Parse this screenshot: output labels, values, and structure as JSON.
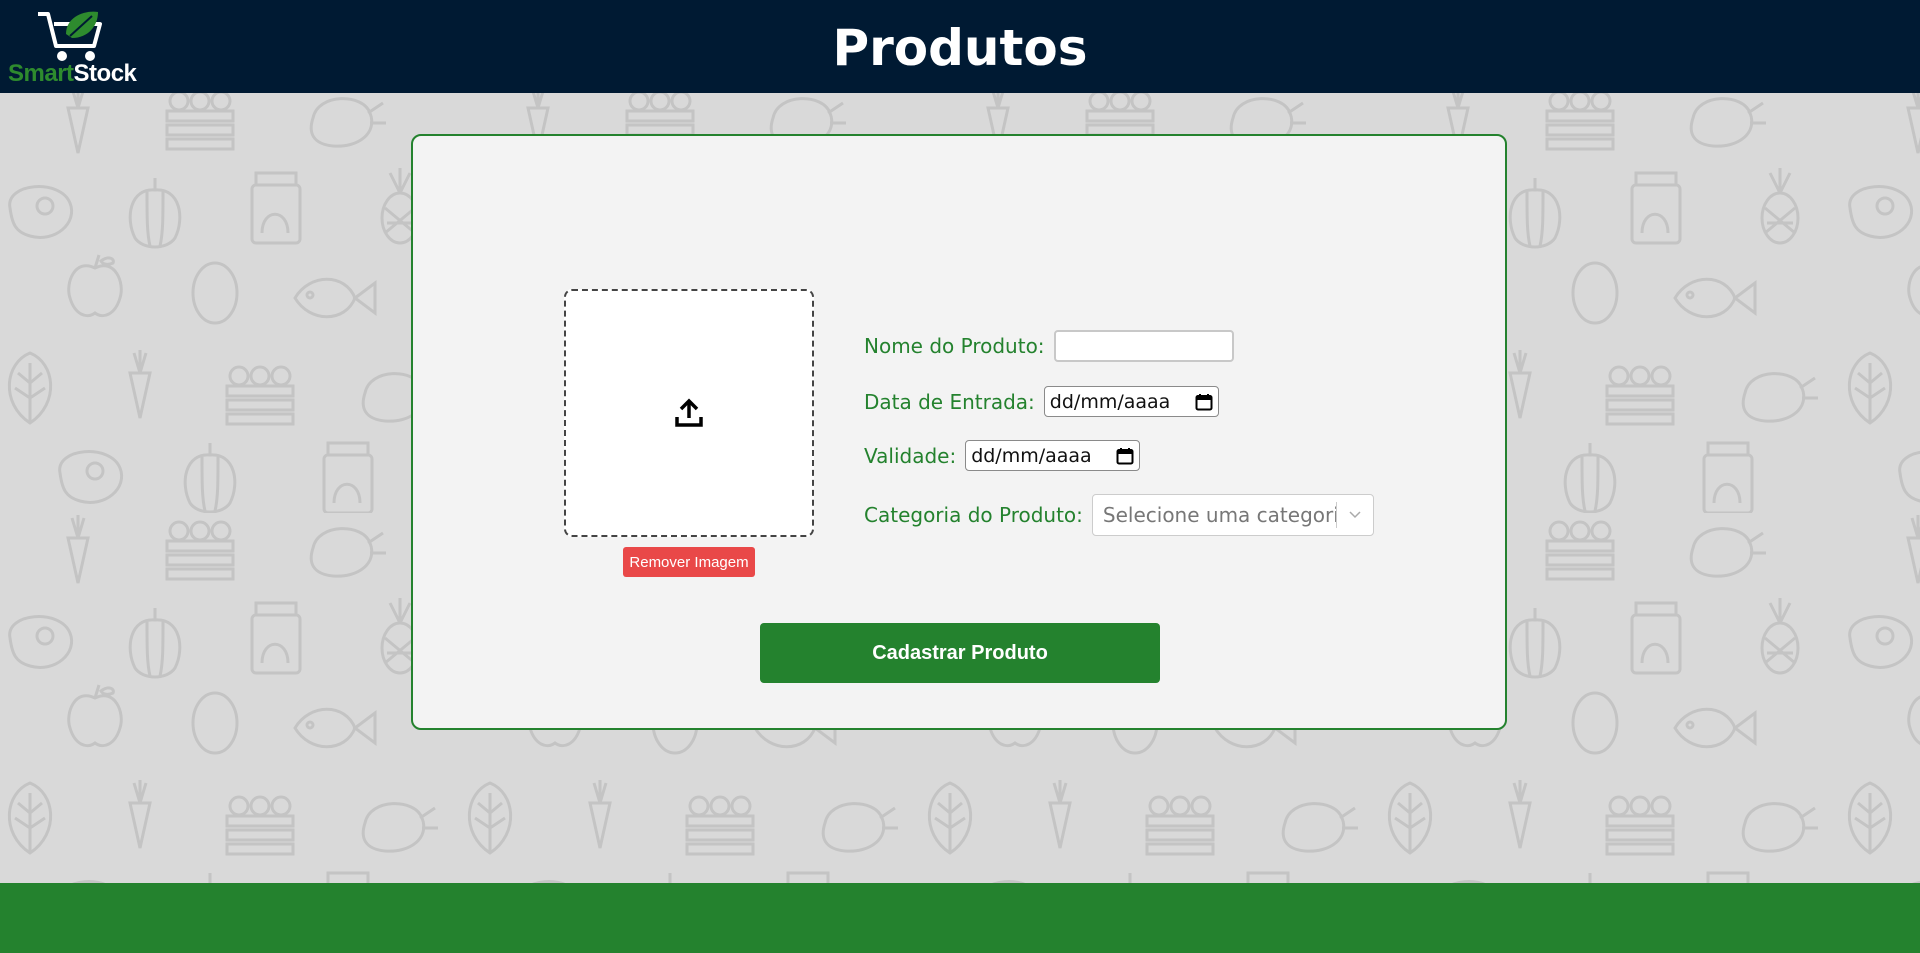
{
  "header": {
    "title": "Produtos",
    "logo": {
      "part1": "Smart",
      "part2": "Stock"
    }
  },
  "upload": {
    "icon": "upload-icon",
    "remove_label": "Remover Imagem"
  },
  "form": {
    "name_label": "Nome do Produto:",
    "name_value": "",
    "entry_label": "Data de Entrada:",
    "entry_value": "dd/mm/aaaa",
    "validity_label": "Validade:",
    "validity_value": "dd/mm/aaaa",
    "category_label": "Categoria do Produto:",
    "category_placeholder": "Selecione uma categoria",
    "submit_label": "Cadastrar Produto"
  },
  "colors": {
    "header_bg": "#001a33",
    "brand_green": "#24822e",
    "danger": "#e94848",
    "page_bg": "#d9d9d9"
  }
}
